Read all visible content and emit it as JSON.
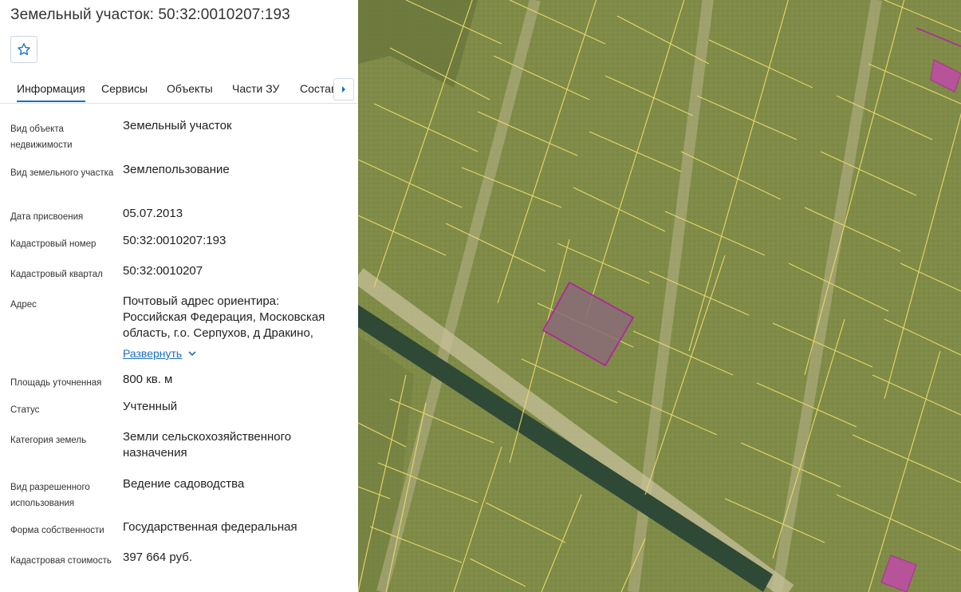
{
  "panel": {
    "title": "Земельный участок: 50:32:0010207:193",
    "favorite_icon": "star-outline-icon",
    "tabs": [
      "Информация",
      "Сервисы",
      "Объекты",
      "Части ЗУ",
      "Состав"
    ],
    "active_tab": "Информация",
    "tabs_scroll_icon": "caret-right-icon",
    "fields": [
      {
        "label": "Вид объекта недвижимости",
        "value": "Земельный участок"
      },
      {
        "label": "Вид земельного участка",
        "value": "Землепользование"
      },
      {
        "label": "Дата присвоения",
        "value": "05.07.2013"
      },
      {
        "label": "Кадастровый номер",
        "value": "50:32:0010207:193"
      },
      {
        "label": "Кадастровый квартал",
        "value": "50:32:0010207"
      },
      {
        "label": "Адрес",
        "value": "Почтовый адрес ориентира: Российская Федерация, Московская область, г.о. Серпухов, д Дракино,",
        "expand_label": "Развернуть"
      },
      {
        "label": "Площадь уточненная",
        "value": "800 кв. м"
      },
      {
        "label": "Статус",
        "value": "Учтенный"
      },
      {
        "label": "Категория земель",
        "value": "Земли сельскохозяйственного назначения"
      },
      {
        "label": "Вид разрешенного использования",
        "value": "Ведение садоводства"
      },
      {
        "label": "Форма собственности",
        "value": "Государственная федеральная"
      },
      {
        "label": "Кадастровая стоимость",
        "value": "397 664 руб."
      }
    ]
  },
  "map": {
    "type": "satellite cadastral map",
    "parcel_line_color": "#e8d76a",
    "highlight_color": "#b0269e",
    "highlight_fill": "#8a6a78"
  }
}
